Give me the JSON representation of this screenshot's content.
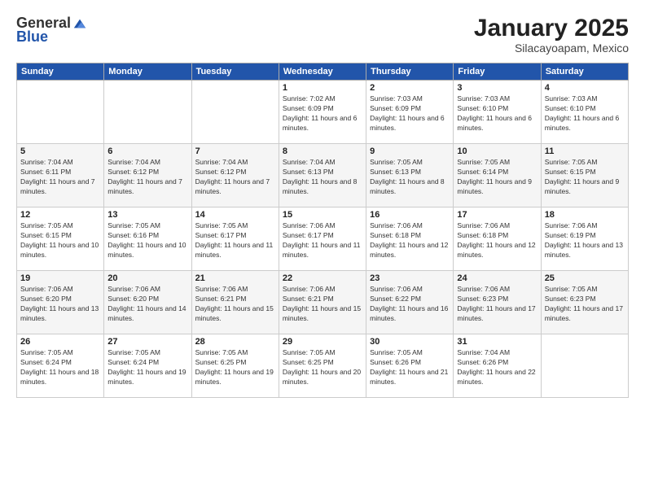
{
  "header": {
    "logo_general": "General",
    "logo_blue": "Blue",
    "month_title": "January 2025",
    "location": "Silacayoapam, Mexico"
  },
  "weekdays": [
    "Sunday",
    "Monday",
    "Tuesday",
    "Wednesday",
    "Thursday",
    "Friday",
    "Saturday"
  ],
  "weeks": [
    [
      {
        "day": "",
        "info": ""
      },
      {
        "day": "",
        "info": ""
      },
      {
        "day": "",
        "info": ""
      },
      {
        "day": "1",
        "info": "Sunrise: 7:02 AM\nSunset: 6:09 PM\nDaylight: 11 hours and 6 minutes."
      },
      {
        "day": "2",
        "info": "Sunrise: 7:03 AM\nSunset: 6:09 PM\nDaylight: 11 hours and 6 minutes."
      },
      {
        "day": "3",
        "info": "Sunrise: 7:03 AM\nSunset: 6:10 PM\nDaylight: 11 hours and 6 minutes."
      },
      {
        "day": "4",
        "info": "Sunrise: 7:03 AM\nSunset: 6:10 PM\nDaylight: 11 hours and 6 minutes."
      }
    ],
    [
      {
        "day": "5",
        "info": "Sunrise: 7:04 AM\nSunset: 6:11 PM\nDaylight: 11 hours and 7 minutes."
      },
      {
        "day": "6",
        "info": "Sunrise: 7:04 AM\nSunset: 6:12 PM\nDaylight: 11 hours and 7 minutes."
      },
      {
        "day": "7",
        "info": "Sunrise: 7:04 AM\nSunset: 6:12 PM\nDaylight: 11 hours and 7 minutes."
      },
      {
        "day": "8",
        "info": "Sunrise: 7:04 AM\nSunset: 6:13 PM\nDaylight: 11 hours and 8 minutes."
      },
      {
        "day": "9",
        "info": "Sunrise: 7:05 AM\nSunset: 6:13 PM\nDaylight: 11 hours and 8 minutes."
      },
      {
        "day": "10",
        "info": "Sunrise: 7:05 AM\nSunset: 6:14 PM\nDaylight: 11 hours and 9 minutes."
      },
      {
        "day": "11",
        "info": "Sunrise: 7:05 AM\nSunset: 6:15 PM\nDaylight: 11 hours and 9 minutes."
      }
    ],
    [
      {
        "day": "12",
        "info": "Sunrise: 7:05 AM\nSunset: 6:15 PM\nDaylight: 11 hours and 10 minutes."
      },
      {
        "day": "13",
        "info": "Sunrise: 7:05 AM\nSunset: 6:16 PM\nDaylight: 11 hours and 10 minutes."
      },
      {
        "day": "14",
        "info": "Sunrise: 7:05 AM\nSunset: 6:17 PM\nDaylight: 11 hours and 11 minutes."
      },
      {
        "day": "15",
        "info": "Sunrise: 7:06 AM\nSunset: 6:17 PM\nDaylight: 11 hours and 11 minutes."
      },
      {
        "day": "16",
        "info": "Sunrise: 7:06 AM\nSunset: 6:18 PM\nDaylight: 11 hours and 12 minutes."
      },
      {
        "day": "17",
        "info": "Sunrise: 7:06 AM\nSunset: 6:18 PM\nDaylight: 11 hours and 12 minutes."
      },
      {
        "day": "18",
        "info": "Sunrise: 7:06 AM\nSunset: 6:19 PM\nDaylight: 11 hours and 13 minutes."
      }
    ],
    [
      {
        "day": "19",
        "info": "Sunrise: 7:06 AM\nSunset: 6:20 PM\nDaylight: 11 hours and 13 minutes."
      },
      {
        "day": "20",
        "info": "Sunrise: 7:06 AM\nSunset: 6:20 PM\nDaylight: 11 hours and 14 minutes."
      },
      {
        "day": "21",
        "info": "Sunrise: 7:06 AM\nSunset: 6:21 PM\nDaylight: 11 hours and 15 minutes."
      },
      {
        "day": "22",
        "info": "Sunrise: 7:06 AM\nSunset: 6:21 PM\nDaylight: 11 hours and 15 minutes."
      },
      {
        "day": "23",
        "info": "Sunrise: 7:06 AM\nSunset: 6:22 PM\nDaylight: 11 hours and 16 minutes."
      },
      {
        "day": "24",
        "info": "Sunrise: 7:06 AM\nSunset: 6:23 PM\nDaylight: 11 hours and 17 minutes."
      },
      {
        "day": "25",
        "info": "Sunrise: 7:05 AM\nSunset: 6:23 PM\nDaylight: 11 hours and 17 minutes."
      }
    ],
    [
      {
        "day": "26",
        "info": "Sunrise: 7:05 AM\nSunset: 6:24 PM\nDaylight: 11 hours and 18 minutes."
      },
      {
        "day": "27",
        "info": "Sunrise: 7:05 AM\nSunset: 6:24 PM\nDaylight: 11 hours and 19 minutes."
      },
      {
        "day": "28",
        "info": "Sunrise: 7:05 AM\nSunset: 6:25 PM\nDaylight: 11 hours and 19 minutes."
      },
      {
        "day": "29",
        "info": "Sunrise: 7:05 AM\nSunset: 6:25 PM\nDaylight: 11 hours and 20 minutes."
      },
      {
        "day": "30",
        "info": "Sunrise: 7:05 AM\nSunset: 6:26 PM\nDaylight: 11 hours and 21 minutes."
      },
      {
        "day": "31",
        "info": "Sunrise: 7:04 AM\nSunset: 6:26 PM\nDaylight: 11 hours and 22 minutes."
      },
      {
        "day": "",
        "info": ""
      }
    ]
  ]
}
